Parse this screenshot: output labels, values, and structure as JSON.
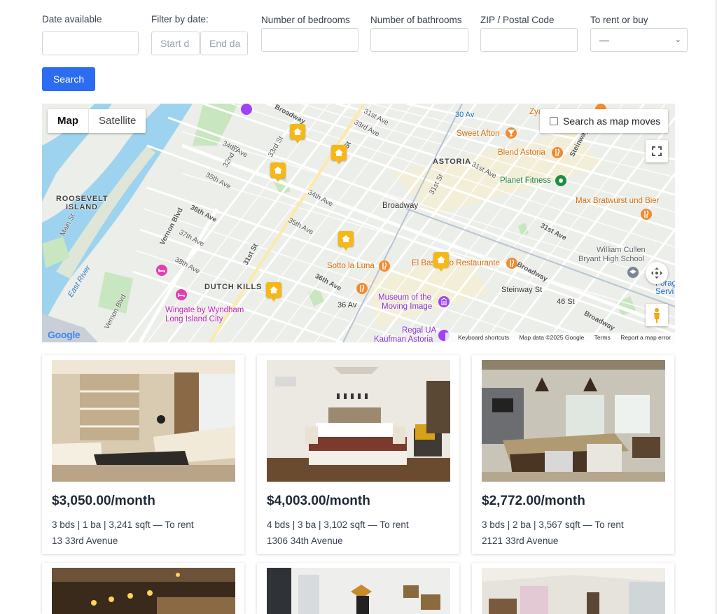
{
  "filters": {
    "date_available": {
      "label": "Date available",
      "value": ""
    },
    "filter_by_date": {
      "label": "Filter by date:",
      "start_placeholder": "Start d",
      "end_placeholder": "End da"
    },
    "bedrooms": {
      "label": "Number of bedrooms",
      "value": ""
    },
    "bathrooms": {
      "label": "Number of bathrooms",
      "value": ""
    },
    "zip": {
      "label": "ZIP / Postal Code",
      "value": ""
    },
    "rent_or_buy": {
      "label": "To rent or buy",
      "selected": "—"
    },
    "search_label": "Search"
  },
  "map": {
    "type_controls": [
      "Map",
      "Satellite"
    ],
    "search_as_moves": "Search as map moves",
    "logo": "Google",
    "footer": [
      "Keyboard shortcuts",
      "Map data ©2025 Google",
      "Terms",
      "Report a map error"
    ],
    "areas": [
      "ROOSEVELT",
      "ISLAND",
      "ASTORIA",
      "DUTCH KILLS"
    ],
    "places": {
      "sweet_afton": "Sweet Afton",
      "blend_astoria": "Blend Astoria",
      "planet_fitness": "Planet Fitness",
      "max_bratwurst": "Max Bratwurst und Bier",
      "william_cullen_1": "William Cullen",
      "william_cullen_2": "Bryant High School",
      "sotto_la_luna": "Sotto la Luna",
      "el_basurero": "El Basurero Restaurante",
      "museum_1": "Museum of the",
      "museum_2": "Moving Image",
      "regal_1": "Regal UA",
      "regal_2": "Kaufman Astoria",
      "wingate_1": "Wingate by Wyndham",
      "wingate_2": "Long Island City",
      "forage_1": "Forage",
      "forage_2": "Servi",
      "zya": "Zya"
    },
    "water": "East River",
    "stations": [
      "30 Av",
      "Broadway",
      "36 Av",
      "Steinway St",
      "46 St"
    ],
    "streets": [
      "31st Ave",
      "32nd St",
      "33rd St",
      "34th Ave",
      "35th Ave",
      "36th Ave",
      "37th Ave",
      "38th Ave",
      "31st St",
      "21st St",
      "Broadway",
      "Vernon Blvd",
      "Main St",
      "Steinway St",
      "33rd Ave",
      "35th Ave"
    ]
  },
  "listings": [
    {
      "price": "$3,050.00/month",
      "details": "3 bds | 1 ba | 3,241 sqft — To rent",
      "address": "13 33rd Avenue"
    },
    {
      "price": "$4,003.00/month",
      "details": "4 bds | 3 ba | 3,102 sqft — To rent",
      "address": "1306 34th Avenue"
    },
    {
      "price": "$2,772.00/month",
      "details": "3 bds | 2 ba | 3,567 sqft — To rent",
      "address": "2121 33rd Avenue"
    }
  ],
  "colors": {
    "accent": "#2b6cf0",
    "pin": "#f6b817",
    "water": "#9dd3ee",
    "park": "#c8e6c0"
  }
}
